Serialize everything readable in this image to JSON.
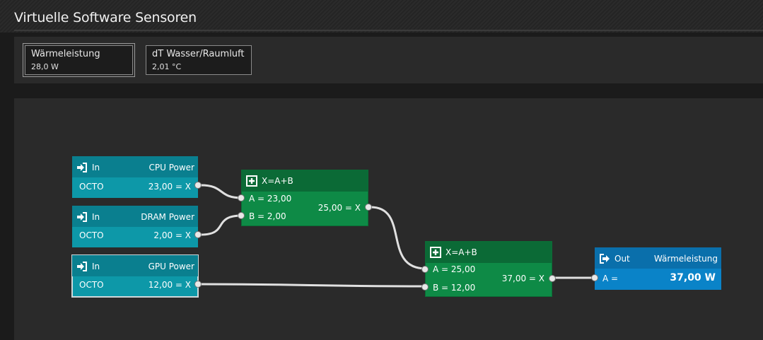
{
  "window": {
    "title": "Virtuelle Software Sensoren"
  },
  "sensors": [
    {
      "name": "Wärmeleistung",
      "value": "28,0 W"
    },
    {
      "name": "dT Wasser/Raumluft",
      "value": "2,01 °C"
    }
  ],
  "nodes": {
    "in1": {
      "type": "In",
      "source": "CPU Power",
      "device": "OCTO",
      "output": "23,00 = X"
    },
    "in2": {
      "type": "In",
      "source": "DRAM Power",
      "device": "OCTO",
      "output": "2,00 = X"
    },
    "in3": {
      "type": "In",
      "source": "GPU Power",
      "device": "OCTO",
      "output": "12,00 = X"
    },
    "add1": {
      "formula": "X=A+B",
      "a": "A = 23,00",
      "b": "B = 2,00",
      "output": "25,00 = X"
    },
    "add2": {
      "formula": "X=A+B",
      "a": "A = 25,00",
      "b": "B = 12,00",
      "output": "37,00 = X"
    },
    "out1": {
      "type": "Out",
      "target": "Wärmeleistung",
      "input": "A =",
      "value": "37,00 W"
    }
  },
  "icons": {
    "in": "sign-in-icon",
    "add": "plus-square-icon",
    "out": "sign-out-icon"
  }
}
